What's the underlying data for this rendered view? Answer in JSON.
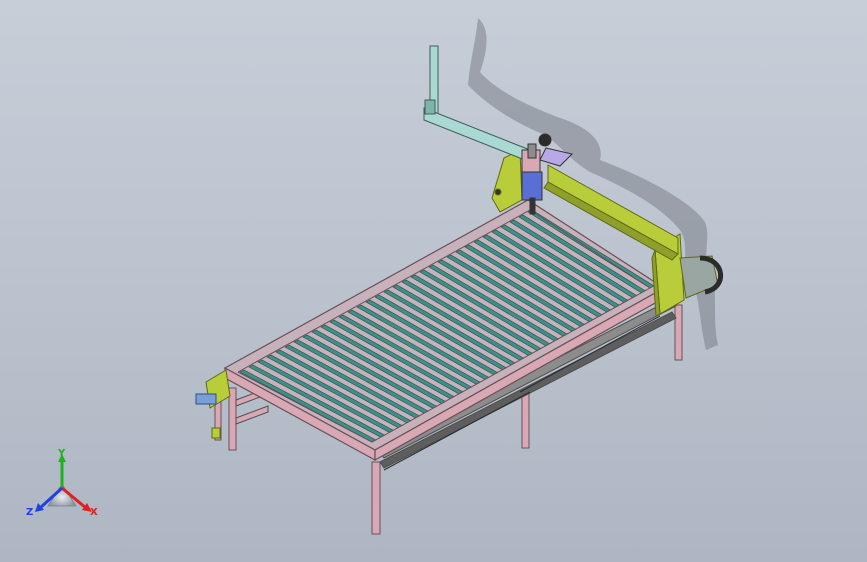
{
  "viewport": {
    "background_top": "#c7ced8",
    "background_bottom": "#aeb6c3",
    "model_colors": {
      "frame": "#d8a8b4",
      "frame_edge": "#6b4f58",
      "slats": "#3f8f88",
      "slat_edge": "#1f4f4b",
      "gantry": "#b9cc3a",
      "gantry_edge": "#5d6a14",
      "arm": "#a9d9d2",
      "torch": "#5a6fd6",
      "shadow": "#6f747c"
    }
  },
  "triad": {
    "x_label": "X",
    "y_label": "Y",
    "z_label": "Z",
    "x_color": "#e02020",
    "y_color": "#20b020",
    "z_color": "#2040e0"
  }
}
